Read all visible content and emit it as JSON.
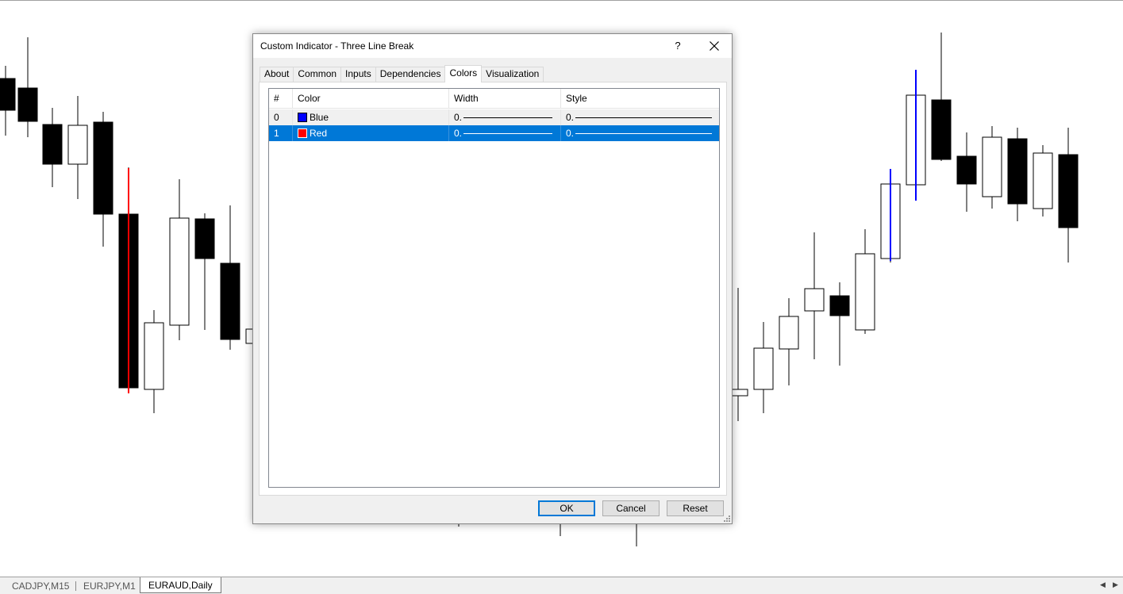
{
  "dialog": {
    "title": "Custom Indicator - Three Line Break",
    "help_label": "?",
    "tabs": [
      {
        "label": "About"
      },
      {
        "label": "Common"
      },
      {
        "label": "Inputs"
      },
      {
        "label": "Dependencies"
      },
      {
        "label": "Colors",
        "active": true
      },
      {
        "label": "Visualization"
      }
    ],
    "grid": {
      "headers": [
        "#",
        "Color",
        "Width",
        "Style"
      ],
      "rows": [
        {
          "index": "0",
          "color_name": "Blue",
          "color_hex": "#0000ff",
          "width": "0.",
          "selected": false
        },
        {
          "index": "1",
          "color_name": "Red",
          "color_hex": "#ff0000",
          "width": "0.",
          "selected": true
        }
      ],
      "style_prefix": "0."
    },
    "buttons": {
      "ok": "OK",
      "cancel": "Cancel",
      "reset": "Reset"
    }
  },
  "chart_tabs": [
    {
      "label": "CADJPY,M15",
      "active": false
    },
    {
      "label": "EURJPY,M1",
      "active": false
    },
    {
      "label": "EURAUD,Daily",
      "active": true
    }
  ],
  "colors": {
    "accent": "#0078d7",
    "bull_line": "#0000ff",
    "bear_line": "#ff0000"
  }
}
